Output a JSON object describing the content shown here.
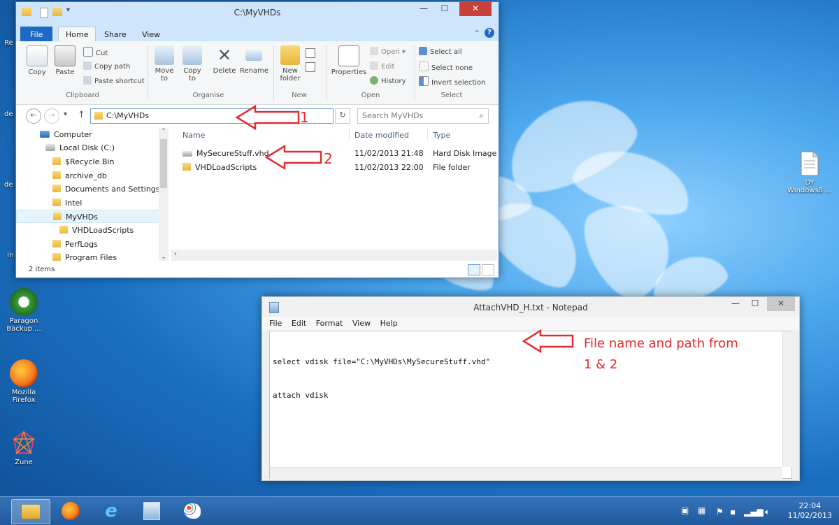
{
  "explorer": {
    "title": "C:\\MyVHDs",
    "tabs": {
      "file": "File",
      "home": "Home",
      "share": "Share",
      "view": "View"
    },
    "ribbon": {
      "copy": "Copy",
      "paste": "Paste",
      "cut": "Cut",
      "copy_path": "Copy path",
      "paste_shortcut": "Paste shortcut",
      "move_to": "Move\nto",
      "copy_to": "Copy\nto",
      "delete": "Delete",
      "rename": "Rename",
      "new_folder": "New\nfolder",
      "properties": "Properties",
      "open": "Open",
      "edit": "Edit",
      "history": "History",
      "select_all": "Select all",
      "select_none": "Select none",
      "invert_selection": "Invert selection",
      "groups": {
        "clipboard": "Clipboard",
        "organise": "Organise",
        "new": "New",
        "open": "Open",
        "select": "Select"
      }
    },
    "address": "C:\\MyVHDs",
    "search_placeholder": "Search MyVHDs",
    "nav": [
      "Computer",
      "Local Disk (C:)",
      "$Recycle.Bin",
      "archive_db",
      "Documents and Settings",
      "Intel",
      "MyVHDs",
      "VHDLoadScripts",
      "PerfLogs",
      "Program Files"
    ],
    "columns": {
      "name": "Name",
      "date": "Date modified",
      "type": "Type"
    },
    "files": [
      {
        "name": "MySecureStuff.vhd",
        "date": "11/02/2013 21:48",
        "type": "Hard Disk Image F..."
      },
      {
        "name": "VHDLoadScripts",
        "date": "11/02/2013 22:00",
        "type": "File folder"
      }
    ],
    "status": "2 items",
    "annotations": {
      "one": "1",
      "two": "2"
    }
  },
  "notepad": {
    "title": "AttachVHD_H.txt - Notepad",
    "menu": [
      "File",
      "Edit",
      "Format",
      "View",
      "Help"
    ],
    "line1": "select vdisk file=\"C:\\MyVHDs\\MySecureStuff.vhd\"",
    "line2": "attach vdisk",
    "annotation_line1": "File name and path from",
    "annotation_line2": "1 & 2"
  },
  "desktop": {
    "icons": {
      "paragon": "Paragon\nBackup ...",
      "firefox": "Mozilla\nFirefox",
      "zune": "Zune",
      "file_right_1": "DY",
      "file_right_2": "Windows8 ..."
    },
    "edge_labels": [
      "Re",
      "de",
      "de",
      "In"
    ]
  },
  "taskbar": {
    "time": "22:04",
    "date": "11/02/2013"
  }
}
